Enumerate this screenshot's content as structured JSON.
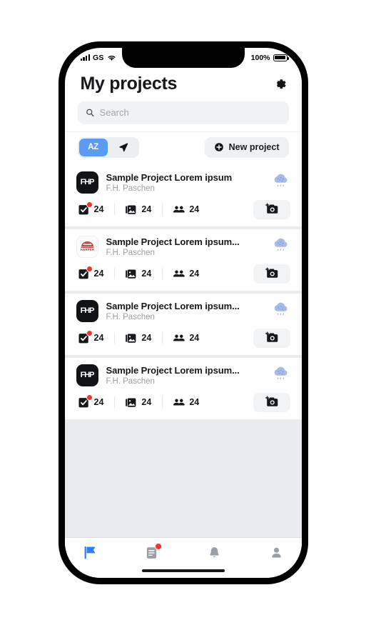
{
  "status_bar": {
    "carrier": "GS",
    "signal_icon": "signal-bars-icon",
    "wifi_icon": "wifi-icon",
    "battery_percent": "100%",
    "battery_icon": "battery-full-icon"
  },
  "header": {
    "title": "My projects",
    "settings_icon": "gear-icon"
  },
  "search": {
    "placeholder": "Search",
    "value": "",
    "icon": "search-icon"
  },
  "toolbar": {
    "sort_alpha_label": "AZ",
    "sort_alpha_icon": "sort-alphabetical-icon",
    "sort_alpha_active": true,
    "location_icon": "navigation-arrow-icon",
    "new_project_label": "New project",
    "new_project_icon": "plus-circle-icon"
  },
  "colors": {
    "accent_blue": "#5b9bf8",
    "badge_red": "#ff2d2d",
    "weather_blue": "#a8bbe8",
    "list_background": "#e9ebee",
    "chip_gray": "#eceef0"
  },
  "projects": [
    {
      "logo_type": "fhp",
      "logo_text": "FHP",
      "title": "Sample Project Lorem ipsum",
      "subtitle": "F.H. Paschen",
      "weather_icon": "rain-cloud-icon",
      "stats": [
        {
          "icon": "checklist-icon",
          "value": "24",
          "has_badge": true
        },
        {
          "icon": "photos-icon",
          "value": "24",
          "has_badge": false
        },
        {
          "icon": "people-icon",
          "value": "24",
          "has_badge": false
        }
      ],
      "camera_icon": "add-photo-camera-icon"
    },
    {
      "logo_type": "harper",
      "logo_text": "HARPER",
      "title": "Sample Project Lorem ipsum...",
      "subtitle": "F.H. Paschen",
      "weather_icon": "rain-cloud-icon",
      "stats": [
        {
          "icon": "checklist-icon",
          "value": "24",
          "has_badge": true
        },
        {
          "icon": "photos-icon",
          "value": "24",
          "has_badge": false
        },
        {
          "icon": "people-icon",
          "value": "24",
          "has_badge": false
        }
      ],
      "camera_icon": "add-photo-camera-icon"
    },
    {
      "logo_type": "fhp",
      "logo_text": "FHP",
      "title": "Sample Project Lorem ipsum...",
      "subtitle": "F.H. Paschen",
      "weather_icon": "rain-cloud-icon",
      "stats": [
        {
          "icon": "checklist-icon",
          "value": "24",
          "has_badge": true
        },
        {
          "icon": "photos-icon",
          "value": "24",
          "has_badge": false
        },
        {
          "icon": "people-icon",
          "value": "24",
          "has_badge": false
        }
      ],
      "camera_icon": "add-photo-camera-icon"
    },
    {
      "logo_type": "fhp",
      "logo_text": "FHP",
      "title": "Sample Project Lorem ipsum...",
      "subtitle": "F.H. Paschen",
      "weather_icon": "rain-cloud-icon",
      "stats": [
        {
          "icon": "checklist-icon",
          "value": "24",
          "has_badge": true
        },
        {
          "icon": "photos-icon",
          "value": "24",
          "has_badge": false
        },
        {
          "icon": "people-icon",
          "value": "24",
          "has_badge": false
        }
      ],
      "camera_icon": "add-photo-camera-icon"
    }
  ],
  "tabbar": {
    "items": [
      {
        "icon": "flag-icon",
        "active": true,
        "has_badge": false
      },
      {
        "icon": "document-notes-icon",
        "active": false,
        "has_badge": true
      },
      {
        "icon": "bell-icon",
        "active": false,
        "has_badge": false
      },
      {
        "icon": "person-icon",
        "active": false,
        "has_badge": false
      }
    ]
  }
}
